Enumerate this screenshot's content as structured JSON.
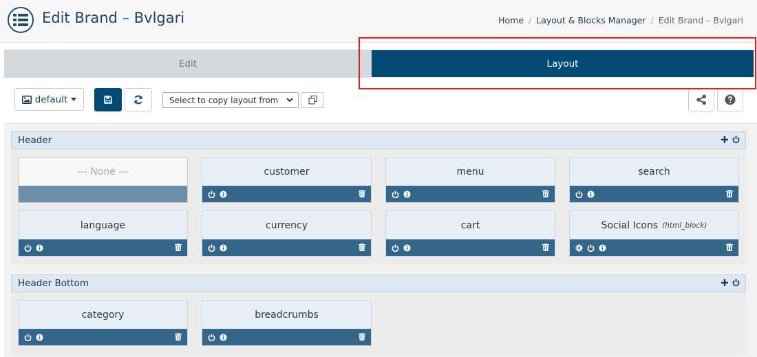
{
  "header": {
    "title": "Edit Brand – Bvlgari",
    "breadcrumb": [
      "Home",
      "Layout & Blocks Manager",
      "Edit Brand – Bvlgari"
    ]
  },
  "tabs": [
    {
      "label": "Edit",
      "active": false
    },
    {
      "label": "Layout",
      "active": true
    }
  ],
  "toolbar": {
    "variant_label": "default",
    "copy_placeholder": "Select to copy layout from"
  },
  "sections": [
    {
      "title": "Header",
      "modules": [
        {
          "name": "--- None ---",
          "empty": true
        },
        {
          "name": "customer"
        },
        {
          "name": "menu"
        },
        {
          "name": "search"
        },
        {
          "name": "language"
        },
        {
          "name": "currency"
        },
        {
          "name": "cart"
        },
        {
          "name": "Social Icons",
          "type": "(html_block)",
          "configurable": true
        }
      ]
    },
    {
      "title": "Header Bottom",
      "modules": [
        {
          "name": "category"
        },
        {
          "name": "breadcrumbs"
        }
      ]
    }
  ],
  "colors": {
    "primary": "#044a76",
    "module_bar": "#34668c",
    "highlight": "#e4201c",
    "section_header_bg": "#dde8f2"
  }
}
